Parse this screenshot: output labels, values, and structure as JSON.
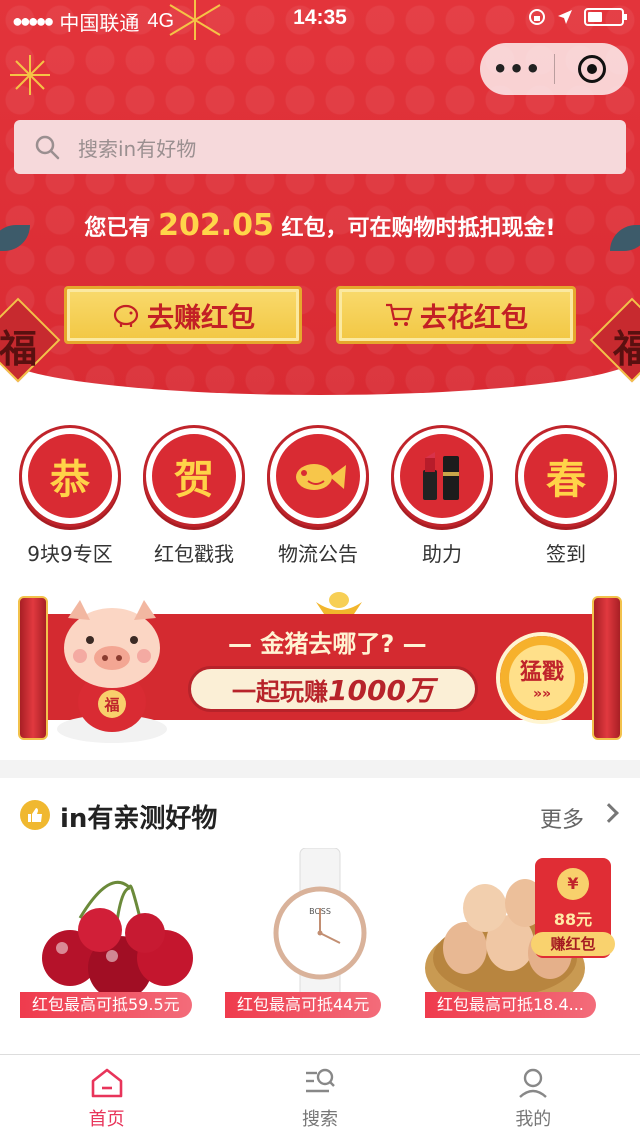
{
  "status_bar": {
    "carrier": "中国联通",
    "network": "4G",
    "time": "14:35"
  },
  "capsule": {
    "more": "•••"
  },
  "search": {
    "placeholder": "搜索in有好物"
  },
  "balance": {
    "prefix": "您已有",
    "amount": "202.05",
    "suffix": "红包，可在购物时抵扣现金!"
  },
  "actions": {
    "earn": "去赚红包",
    "spend": "去花红包"
  },
  "decor": {
    "fu": "福"
  },
  "categories": [
    {
      "glyph": "恭",
      "label": "9块9专区"
    },
    {
      "glyph": "贺",
      "label": "红包戳我"
    },
    {
      "glyph": "",
      "label": "物流公告"
    },
    {
      "glyph": "",
      "label": "助力"
    },
    {
      "glyph": "春",
      "label": "签到"
    }
  ],
  "banner": {
    "title": "— 金猪去哪了? —",
    "pill_prefix": "一起玩赚",
    "pill_amount": "1000万",
    "button": "猛戳",
    "badge": "福"
  },
  "section": {
    "title": "in有亲测好物",
    "more": "更多"
  },
  "products": [
    {
      "tag": "红包最高可抵59.5元"
    },
    {
      "tag": "红包最高可抵44元"
    },
    {
      "tag": "红包最高可抵18.4...",
      "redpack_amount": "88元",
      "redpack_button": "赚红包",
      "redpack_symbol": "¥",
      "watch_brand": "BOSS"
    }
  ],
  "tabs": [
    {
      "label": "首页",
      "active": true
    },
    {
      "label": "搜索",
      "active": false
    },
    {
      "label": "我的",
      "active": false
    }
  ],
  "colors": {
    "primary_red": "#d92b33",
    "gold": "#f2c743",
    "active_tab": "#e8345a"
  }
}
